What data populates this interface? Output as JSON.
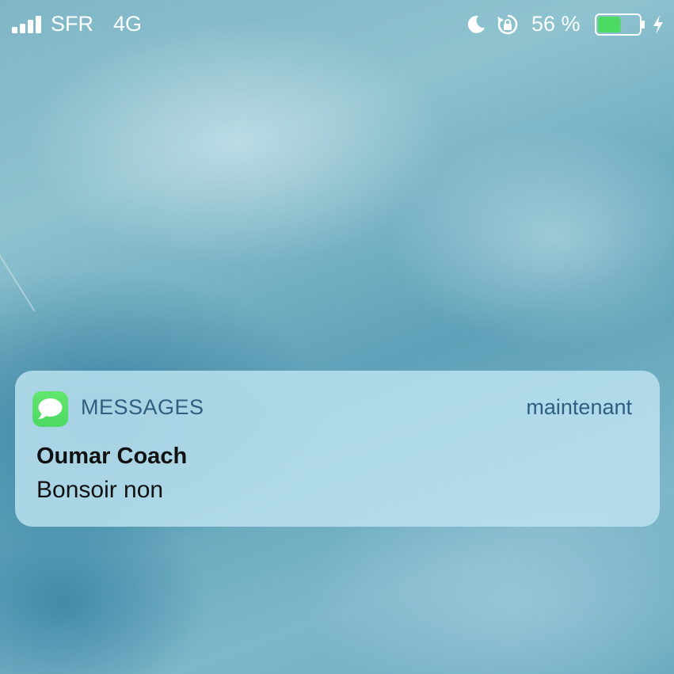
{
  "status_bar": {
    "carrier": "SFR",
    "network": "4G",
    "battery_percent": "56 %",
    "battery_level": 0.56,
    "battery_fill_color": "#4cd964",
    "signal_bars": 4,
    "icons": [
      "signal-icon",
      "moon-icon",
      "lock-rotation-icon",
      "battery-icon",
      "bolt-icon"
    ]
  },
  "notification": {
    "app_name": "MESSAGES",
    "time": "maintenant",
    "sender": "Oumar Coach",
    "body": "Bonsoir non",
    "app_icon": "messages-icon",
    "app_icon_color": "#4cd964"
  }
}
